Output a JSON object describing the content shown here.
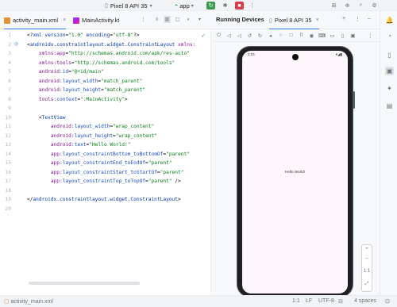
{
  "toolbar": {
    "device": "Pixel 8 API 35",
    "run_config": "app"
  },
  "editor_tabs": [
    {
      "label": "activity_main.xml"
    },
    {
      "label": "MainActivity.kt"
    }
  ],
  "editor": {
    "line_numbers": [
      "1",
      "2",
      "3",
      "4",
      "5",
      "6",
      "7",
      "8",
      "9",
      "10",
      "11",
      "12",
      "13",
      "14",
      "15",
      "16",
      "17",
      "18",
      "19",
      "20"
    ]
  },
  "running_devices": {
    "title": "Running Devices",
    "device_tab": "Pixel 8 API 35"
  },
  "emulator": {
    "status_time": "2:24",
    "hello_text": "Hello World!",
    "zoom_top": "1:1"
  },
  "status_bar": {
    "breadcrumb": "activity_main.xml",
    "position": "1:1",
    "line_sep": "LF",
    "encoding": "UTF-8",
    "indent": "4 spaces"
  },
  "colors": {
    "accent": "#3574f0",
    "run": "#3d9a50",
    "stop": "#db3b4b"
  }
}
